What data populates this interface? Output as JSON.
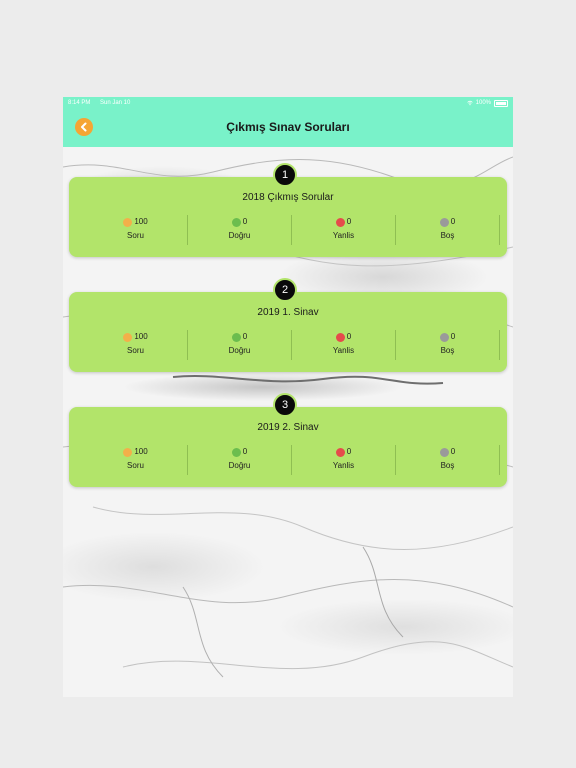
{
  "statusbar": {
    "time": "8:14 PM",
    "date": "Sun Jan 10",
    "battery": "100%"
  },
  "nav": {
    "title": "Çıkmış Sınav Soruları"
  },
  "colors": {
    "nav": "#79f2c9",
    "card": "#b2e46a",
    "back": "#f5a534"
  },
  "exams": [
    {
      "number": "1",
      "title": "2018 Çıkmış Sorular",
      "soru": "100",
      "dogru": "0",
      "yanlis": "0",
      "bos": "0"
    },
    {
      "number": "2",
      "title": "2019 1. Sinav",
      "soru": "100",
      "dogru": "0",
      "yanlis": "0",
      "bos": "0"
    },
    {
      "number": "3",
      "title": "2019 2. Sinav",
      "soru": "100",
      "dogru": "0",
      "yanlis": "0",
      "bos": "0"
    }
  ],
  "labels": {
    "soru": "Soru",
    "dogru": "Doğru",
    "yanlis": "Yanlis",
    "bos": "Boş"
  }
}
